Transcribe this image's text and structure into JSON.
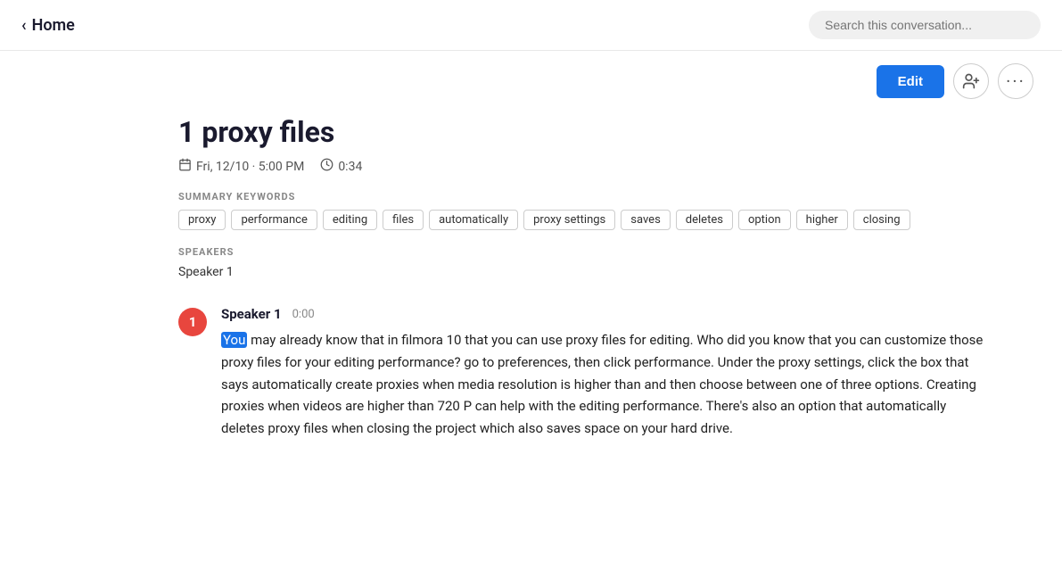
{
  "header": {
    "home_label": "Home",
    "search_placeholder": "Search this conversation..."
  },
  "toolbar": {
    "edit_label": "Edit",
    "add_person_icon": "add-person",
    "more_icon": "more"
  },
  "note": {
    "title": "1 proxy files",
    "date": "Fri, 12/10 · 5:00 PM",
    "duration": "0:34",
    "summary_keywords_label": "SUMMARY KEYWORDS",
    "keywords": [
      "proxy",
      "performance",
      "editing",
      "files",
      "automatically",
      "proxy settings",
      "saves",
      "deletes",
      "option",
      "higher",
      "closing"
    ],
    "speakers_label": "SPEAKERS",
    "speakers": [
      "Speaker 1"
    ]
  },
  "transcript": {
    "speaker_number": "1",
    "speaker_name": "Speaker 1",
    "timestamp": "0:00",
    "highlighted_word": "You",
    "text_after_highlight": " may already know that in filmora 10 that you can use proxy files for editing. Who did you know that you can customize those proxy files for your editing performance? go to preferences, then click performance. Under the proxy settings, click the box that says automatically create proxies when media resolution is higher than and then choose between one of three options. Creating proxies when videos are higher than 720 P can help with the editing performance. There's also an option that automatically deletes proxy files when closing the project which also saves space on your hard drive."
  }
}
